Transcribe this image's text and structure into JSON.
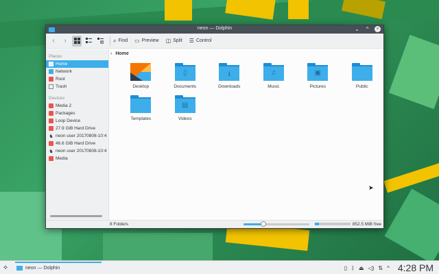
{
  "window": {
    "title": "neon — Dolphin",
    "buttons": {
      "minimize": "⌄",
      "maximize": "^",
      "close": "×"
    }
  },
  "toolbar": {
    "find": "Find",
    "preview": "Preview",
    "split": "Split",
    "control": "Control"
  },
  "sidebar": {
    "places_label": "Places",
    "places": [
      {
        "label": "Home",
        "icon": "home-icon",
        "selected": true
      },
      {
        "label": "Network",
        "icon": "network-icon"
      },
      {
        "label": "Root",
        "icon": "root-folder-icon"
      },
      {
        "label": "Trash",
        "icon": "trash-icon"
      }
    ],
    "devices_label": "Devices",
    "devices": [
      {
        "label": "Media 2",
        "icon": "drive-icon"
      },
      {
        "label": "Packages",
        "icon": "drive-icon"
      },
      {
        "label": "Loop Device",
        "icon": "drive-icon"
      },
      {
        "label": "27.9 GiB Hard Drive",
        "icon": "drive-icon"
      },
      {
        "label": "neon user 20170808-10:4",
        "icon": "user-drive-icon"
      },
      {
        "label": "46.6 GiB Hard Drive",
        "icon": "drive-icon"
      },
      {
        "label": "neon user 20170808-10:4",
        "icon": "user-drive-icon"
      },
      {
        "label": "Media",
        "icon": "drive-icon"
      }
    ]
  },
  "breadcrumb": {
    "current": "Home"
  },
  "files": [
    {
      "label": "Desktop",
      "icon": "desktop-folder-icon"
    },
    {
      "label": "Documents",
      "icon": "documents-folder-icon"
    },
    {
      "label": "Downloads",
      "icon": "downloads-folder-icon"
    },
    {
      "label": "Music",
      "icon": "music-folder-icon"
    },
    {
      "label": "Pictures",
      "icon": "pictures-folder-icon"
    },
    {
      "label": "Public",
      "icon": "public-folder-icon"
    },
    {
      "label": "Templates",
      "icon": "templates-folder-icon"
    },
    {
      "label": "Videos",
      "icon": "videos-folder-icon"
    }
  ],
  "status": {
    "count": "8 Folders",
    "zoom_level": 0.3,
    "free_space": "852.5 MiB free",
    "used_fraction": 0.12
  },
  "taskbar": {
    "task_label": "neon — Dolphin",
    "clock": "4:28 PM"
  },
  "colors": {
    "accent": "#3daee9",
    "titlebar": "#475057"
  }
}
